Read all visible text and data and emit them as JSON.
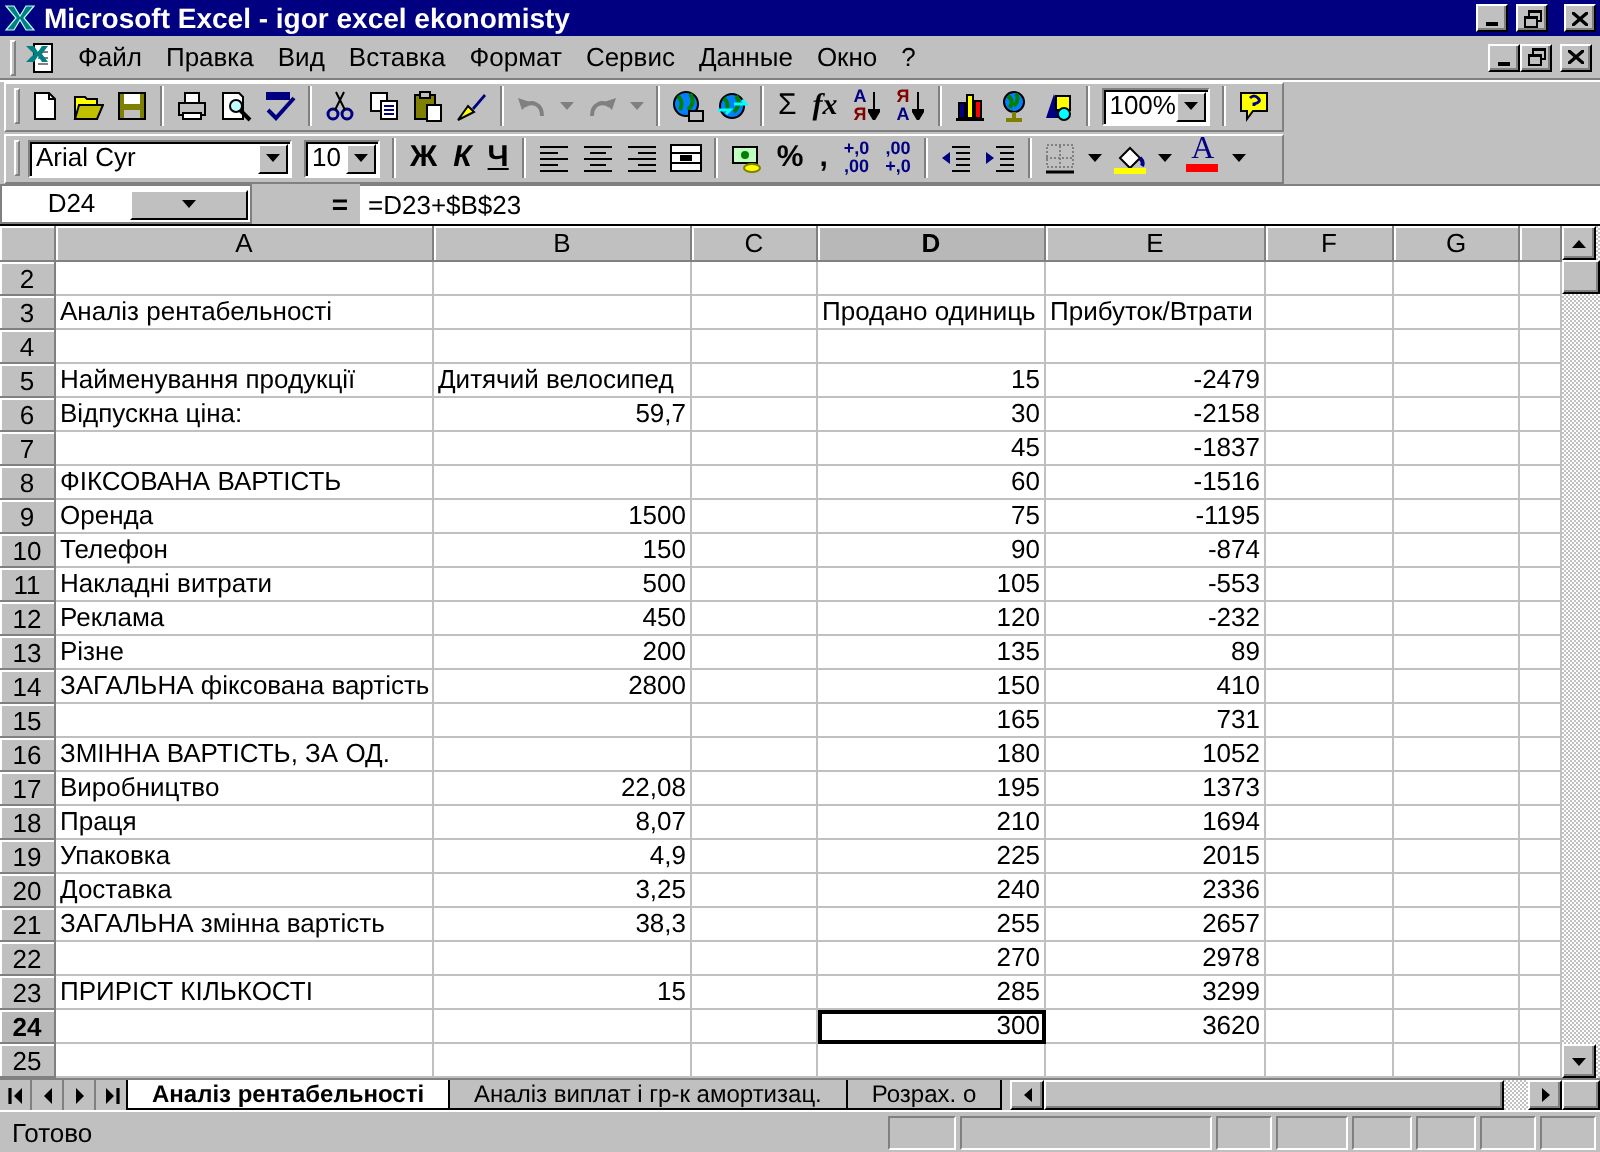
{
  "window": {
    "title": "Microsoft Excel - igor excel ekonomisty"
  },
  "menu": [
    {
      "label": "Файл"
    },
    {
      "label": "Правка"
    },
    {
      "label": "Вид"
    },
    {
      "label": "Вставка"
    },
    {
      "label": "Формат"
    },
    {
      "label": "Сервис"
    },
    {
      "label": "Данные"
    },
    {
      "label": "Окно"
    },
    {
      "label": "?"
    }
  ],
  "standard_toolbar": {
    "sum_label": "Σ",
    "function_label": "fx",
    "sort_ascending": {
      "top": "А",
      "bottom": "Я"
    },
    "sort_descending": {
      "top": "Я",
      "bottom": "А"
    },
    "zoom": "100%"
  },
  "formatting_toolbar": {
    "font": "Arial Cyr",
    "size": "10",
    "bold_label": "Ж",
    "italic_label": "К",
    "underline_label": "Ч",
    "percent_label": "%",
    "comma_label": ",",
    "increase_decimal": {
      "top": "+,0",
      "bottom": ",00"
    },
    "decrease_decimal": {
      "top": ",00",
      "bottom": "+,0"
    },
    "font_color_label": "A"
  },
  "formula_bar": {
    "name_box": "D24",
    "equals_label": "=",
    "formula": "=D23+$B$23"
  },
  "sheet": {
    "columns": [
      {
        "label": "A",
        "selected": false
      },
      {
        "label": "B",
        "selected": false
      },
      {
        "label": "C",
        "selected": false
      },
      {
        "label": "D",
        "selected": true
      },
      {
        "label": "E",
        "selected": false
      },
      {
        "label": "F",
        "selected": false
      },
      {
        "label": "G",
        "selected": false
      }
    ],
    "rows": [
      {
        "number": "2",
        "selected": false,
        "cells": {}
      },
      {
        "number": "3",
        "selected": false,
        "cells": {
          "a": {
            "value": "Аналіз рентабельності",
            "kind": "text"
          },
          "d": {
            "value": "Продано одиниць",
            "kind": "text"
          },
          "e": {
            "value": "Прибуток/Втрати",
            "kind": "text"
          }
        }
      },
      {
        "number": "4",
        "selected": false,
        "cells": {}
      },
      {
        "number": "5",
        "selected": false,
        "cells": {
          "a": {
            "value": "Найменування продукції",
            "kind": "text"
          },
          "b": {
            "value": "Дитячий велосипед",
            "kind": "text"
          },
          "d": {
            "value": "15",
            "kind": "number"
          },
          "e": {
            "value": "-2479",
            "kind": "number"
          }
        }
      },
      {
        "number": "6",
        "selected": false,
        "cells": {
          "a": {
            "value": "Відпускна ціна:",
            "kind": "text"
          },
          "b": {
            "value": "59,7",
            "kind": "number"
          },
          "d": {
            "value": "30",
            "kind": "number"
          },
          "e": {
            "value": "-2158",
            "kind": "number"
          }
        }
      },
      {
        "number": "7",
        "selected": false,
        "cells": {
          "d": {
            "value": "45",
            "kind": "number"
          },
          "e": {
            "value": "-1837",
            "kind": "number"
          }
        }
      },
      {
        "number": "8",
        "selected": false,
        "cells": {
          "a": {
            "value": "ФІКСОВАНА ВАРТІСТЬ",
            "kind": "text"
          },
          "d": {
            "value": "60",
            "kind": "number"
          },
          "e": {
            "value": "-1516",
            "kind": "number"
          }
        }
      },
      {
        "number": "9",
        "selected": false,
        "cells": {
          "a": {
            "value": "Оренда",
            "kind": "text"
          },
          "b": {
            "value": "1500",
            "kind": "number"
          },
          "d": {
            "value": "75",
            "kind": "number"
          },
          "e": {
            "value": "-1195",
            "kind": "number"
          }
        }
      },
      {
        "number": "10",
        "selected": false,
        "cells": {
          "a": {
            "value": "Телефон",
            "kind": "text"
          },
          "b": {
            "value": "150",
            "kind": "number"
          },
          "d": {
            "value": "90",
            "kind": "number"
          },
          "e": {
            "value": "-874",
            "kind": "number"
          }
        }
      },
      {
        "number": "11",
        "selected": false,
        "cells": {
          "a": {
            "value": "Накладні витрати",
            "kind": "text"
          },
          "b": {
            "value": "500",
            "kind": "number"
          },
          "d": {
            "value": "105",
            "kind": "number"
          },
          "e": {
            "value": "-553",
            "kind": "number"
          }
        }
      },
      {
        "number": "12",
        "selected": false,
        "cells": {
          "a": {
            "value": "Реклама",
            "kind": "text"
          },
          "b": {
            "value": "450",
            "kind": "number"
          },
          "d": {
            "value": "120",
            "kind": "number"
          },
          "e": {
            "value": "-232",
            "kind": "number"
          }
        }
      },
      {
        "number": "13",
        "selected": false,
        "cells": {
          "a": {
            "value": "Різне",
            "kind": "text"
          },
          "b": {
            "value": "200",
            "kind": "number"
          },
          "d": {
            "value": "135",
            "kind": "number"
          },
          "e": {
            "value": "89",
            "kind": "number"
          }
        }
      },
      {
        "number": "14",
        "selected": false,
        "cells": {
          "a": {
            "value": "ЗАГАЛЬНА фіксована вартість",
            "kind": "text"
          },
          "b": {
            "value": "2800",
            "kind": "number"
          },
          "d": {
            "value": "150",
            "kind": "number"
          },
          "e": {
            "value": "410",
            "kind": "number"
          }
        }
      },
      {
        "number": "15",
        "selected": false,
        "cells": {
          "d": {
            "value": "165",
            "kind": "number"
          },
          "e": {
            "value": "731",
            "kind": "number"
          }
        }
      },
      {
        "number": "16",
        "selected": false,
        "cells": {
          "a": {
            "value": "ЗМІННА ВАРТІСТЬ, ЗА ОД.",
            "kind": "text"
          },
          "d": {
            "value": "180",
            "kind": "number"
          },
          "e": {
            "value": "1052",
            "kind": "number"
          }
        }
      },
      {
        "number": "17",
        "selected": false,
        "cells": {
          "a": {
            "value": "Виробництво",
            "kind": "text"
          },
          "b": {
            "value": "22,08",
            "kind": "number"
          },
          "d": {
            "value": "195",
            "kind": "number"
          },
          "e": {
            "value": "1373",
            "kind": "number"
          }
        }
      },
      {
        "number": "18",
        "selected": false,
        "cells": {
          "a": {
            "value": "Праця",
            "kind": "text"
          },
          "b": {
            "value": "8,07",
            "kind": "number"
          },
          "d": {
            "value": "210",
            "kind": "number"
          },
          "e": {
            "value": "1694",
            "kind": "number"
          }
        }
      },
      {
        "number": "19",
        "selected": false,
        "cells": {
          "a": {
            "value": "Упаковка",
            "kind": "text"
          },
          "b": {
            "value": "4,9",
            "kind": "number"
          },
          "d": {
            "value": "225",
            "kind": "number"
          },
          "e": {
            "value": "2015",
            "kind": "number"
          }
        }
      },
      {
        "number": "20",
        "selected": false,
        "cells": {
          "a": {
            "value": "Доставка",
            "kind": "text"
          },
          "b": {
            "value": "3,25",
            "kind": "number"
          },
          "d": {
            "value": "240",
            "kind": "number"
          },
          "e": {
            "value": "2336",
            "kind": "number"
          }
        }
      },
      {
        "number": "21",
        "selected": false,
        "cells": {
          "a": {
            "value": "ЗАГАЛЬНА змінна вартість",
            "kind": "text"
          },
          "b": {
            "value": "38,3",
            "kind": "number"
          },
          "d": {
            "value": "255",
            "kind": "number"
          },
          "e": {
            "value": "2657",
            "kind": "number"
          }
        }
      },
      {
        "number": "22",
        "selected": false,
        "cells": {
          "d": {
            "value": "270",
            "kind": "number"
          },
          "e": {
            "value": "2978",
            "kind": "number"
          }
        }
      },
      {
        "number": "23",
        "selected": false,
        "cells": {
          "a": {
            "value": "ПРИРІСТ КІЛЬКОСТІ",
            "kind": "text"
          },
          "b": {
            "value": "15",
            "kind": "number"
          },
          "d": {
            "value": "285",
            "kind": "number"
          },
          "e": {
            "value": "3299",
            "kind": "number"
          }
        }
      },
      {
        "number": "24",
        "selected": true,
        "cells": {
          "d": {
            "value": "300",
            "kind": "number"
          },
          "e": {
            "value": "3620",
            "kind": "number"
          }
        }
      },
      {
        "number": "25",
        "selected": false,
        "cells": {}
      }
    ]
  },
  "sheet_tabs": [
    {
      "label": "Аналіз рентабельності",
      "selected": true
    },
    {
      "label": "Аналіз виплат і гр-к амортизац.",
      "selected": false
    },
    {
      "label": "Розрах. о",
      "selected": false
    }
  ],
  "status_bar": {
    "text": "Готово"
  }
}
